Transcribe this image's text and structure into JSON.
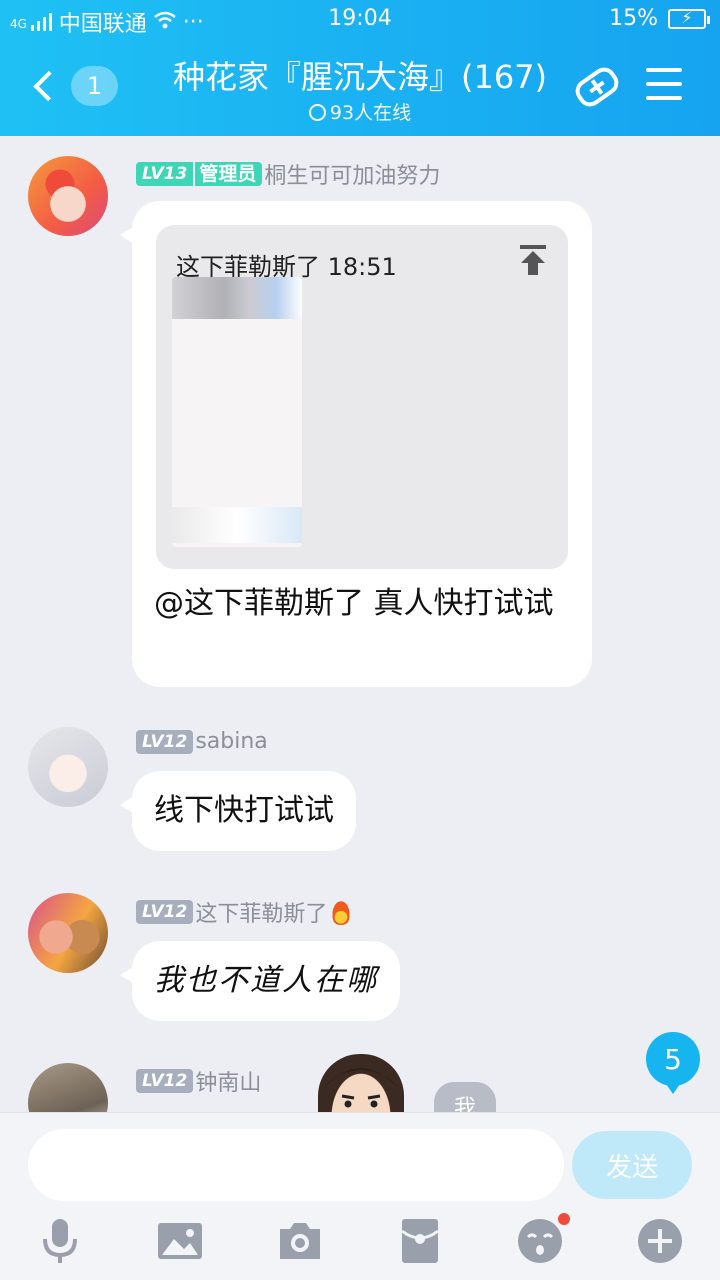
{
  "status_bar": {
    "network_type": "4G",
    "carrier": "中国联通",
    "more": "···",
    "time": "19:04",
    "battery_percent": "15%",
    "battery_charging": "⚡"
  },
  "header": {
    "back_count": "1",
    "title": "种花家『腥沉大海』(167)",
    "online": "93人在线"
  },
  "messages": [
    {
      "level": "LV13",
      "role": "管理员",
      "sender": "桐生可可加油努力",
      "quote_header": "这下菲勒斯了 18:51",
      "text": "@这下菲勒斯了 真人快打试试"
    },
    {
      "level": "LV12",
      "sender": "sabina",
      "text": "线下快打试试"
    },
    {
      "level": "LV12",
      "sender": "这下菲勒斯了",
      "text": "我也不道人在哪"
    },
    {
      "level": "LV12",
      "sender": "钟南山",
      "text": ""
    }
  ],
  "overlay": {
    "peek_label": "我",
    "unread_count": "5"
  },
  "input_bar": {
    "placeholder": "",
    "send_label": "发送"
  },
  "toolbar_icons": [
    "microphone-icon",
    "image-icon",
    "camera-icon",
    "red-packet-icon",
    "emoji-icon",
    "plus-icon"
  ],
  "colors": {
    "header": "#1ab0f2",
    "admin_badge": "#3fd6b8",
    "level_badge": "#a7aebd",
    "unread_badge": "#16b5f0",
    "send_button": "#bfe9f9"
  }
}
